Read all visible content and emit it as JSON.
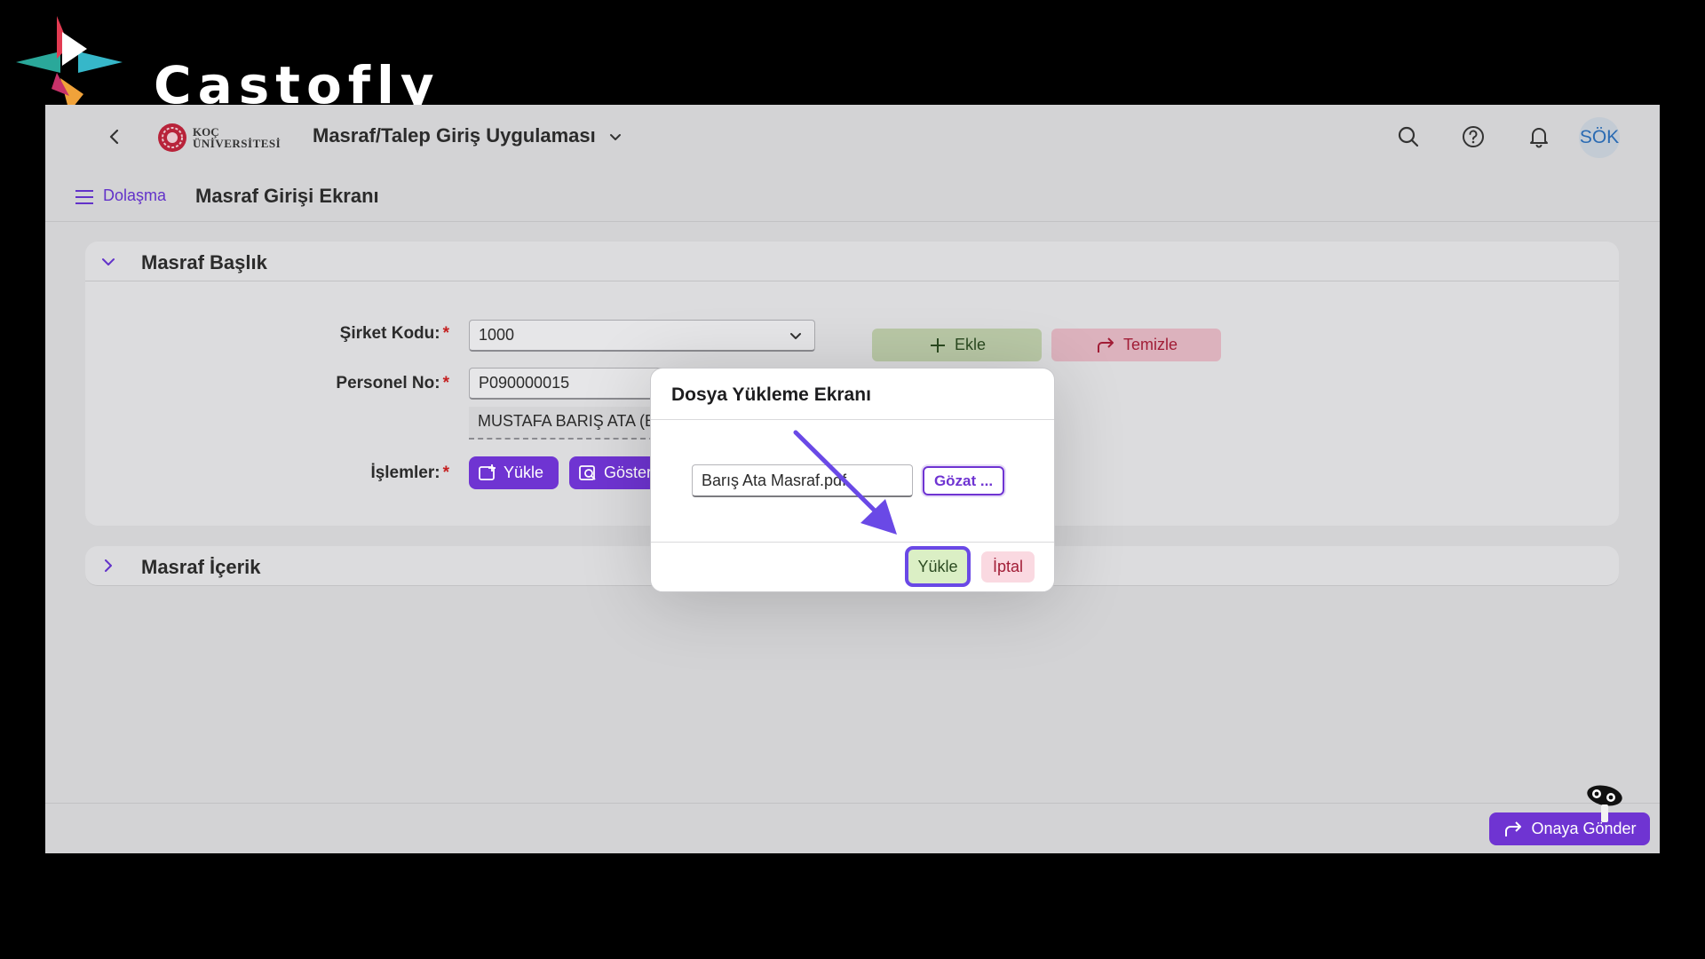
{
  "brand": {
    "name": "Castofly"
  },
  "shellbar": {
    "logo_line1": "KOÇ",
    "logo_line2": "ÜNİVERSİTESİ",
    "app_title": "Masraf/Talep Giriş Uygulaması",
    "avatar_initials": "SÖK",
    "icons": [
      "search-icon",
      "help-icon",
      "bell-icon"
    ]
  },
  "subheader": {
    "nav_label": "Dolaşma",
    "page_title": "Masraf Girişi Ekranı"
  },
  "section_header": {
    "title": "Masraf Başlık",
    "fields": {
      "company_code_label": "Şirket Kodu:",
      "company_code_value": "1000",
      "personnel_no_label": "Personel No:",
      "personnel_no_value": "P090000015",
      "personnel_name": "MUSTAFA BARIŞ  ATA (BİRİM",
      "operations_label": "İşlemler:",
      "required_mark": "*"
    },
    "buttons": {
      "upload": "Yükle",
      "show": "Göster",
      "add": "Ekle",
      "clear": "Temizle"
    }
  },
  "section_content": {
    "title": "Masraf İçerik"
  },
  "footer": {
    "submit_label": "Onaya Gönder"
  },
  "dialog": {
    "title": "Dosya Yükleme Ekranı",
    "file_value": "Barış Ata  Masraf.pdf",
    "browse_label": "Gözat ...",
    "upload_label": "Yükle",
    "cancel_label": "İptal"
  },
  "colors": {
    "accent": "#6f34d2",
    "highlight": "#6a49e6",
    "success_bg": "#dbefc5",
    "danger_text": "#a11d36"
  }
}
